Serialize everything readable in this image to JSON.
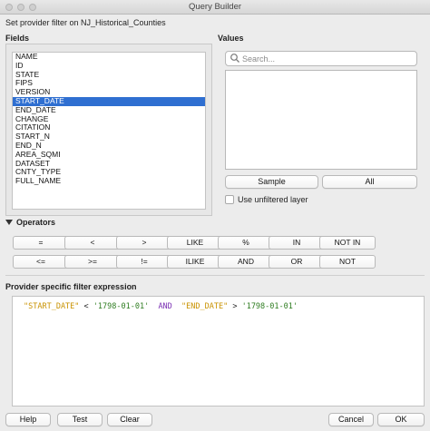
{
  "window": {
    "title": "Query Builder"
  },
  "subtitle": "Set provider filter on NJ_Historical_Counties",
  "fields": {
    "label": "Fields",
    "items": [
      "NAME",
      "ID",
      "STATE",
      "FIPS",
      "VERSION",
      "START_DATE",
      "END_DATE",
      "CHANGE",
      "CITATION",
      "START_N",
      "END_N",
      "AREA_SQMI",
      "DATASET",
      "CNTY_TYPE",
      "FULL_NAME"
    ],
    "selected": "START_DATE"
  },
  "values": {
    "label": "Values",
    "search_placeholder": "Search...",
    "sample_label": "Sample",
    "all_label": "All",
    "unfiltered_label": "Use unfiltered layer"
  },
  "operators": {
    "label": "Operators",
    "row1": [
      "=",
      "<",
      ">",
      "LIKE",
      "%",
      "IN",
      "NOT IN"
    ],
    "row2": [
      "<=",
      ">=",
      "!=",
      "ILIKE",
      "AND",
      "OR",
      "NOT"
    ]
  },
  "expression": {
    "label": "Provider specific filter expression",
    "tokens": {
      "field1": "\"START_DATE\"",
      "op1": " < ",
      "val1": "'1798-01-01'",
      "kw": "  AND  ",
      "field2": "\"END_DATE\"",
      "op2": " > ",
      "val2": "'1798-01-01'"
    }
  },
  "buttons": {
    "help": "Help",
    "test": "Test",
    "clear": "Clear",
    "cancel": "Cancel",
    "ok": "OK"
  }
}
